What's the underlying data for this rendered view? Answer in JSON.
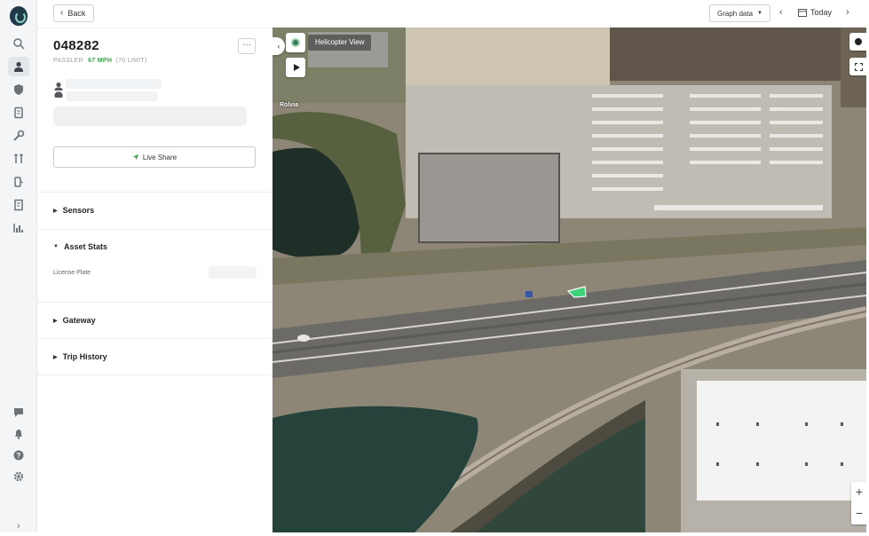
{
  "nav": {
    "back_label": "Back",
    "rail_icons": [
      "search-icon",
      "driver-icon",
      "shield-icon",
      "document-icon",
      "wrench-icon",
      "route-icon",
      "fuel-icon",
      "checklist-icon",
      "reports-icon",
      "chat-icon",
      "bell-icon",
      "help-icon",
      "settings-icon",
      "expand-icon"
    ],
    "expand_glyph": "›"
  },
  "asset": {
    "title": "048282",
    "type": "PASSLER",
    "speed": "67 MPH",
    "limit": "(70 LIMIT)"
  },
  "live_share_label": "Live Share",
  "sections": {
    "sensors": "Sensors",
    "asset_stats": "Asset Stats",
    "license_plate_label": "License Plate",
    "gateway": "Gateway",
    "trip_history": "Trip History"
  },
  "header": {
    "graph_data_label": "Graph data",
    "today_label": "Today",
    "prev_glyph": "‹",
    "next_glyph": "›"
  },
  "map": {
    "helicopter_view_label": "Helicopter View",
    "place_label": "Rolvia",
    "zoom_in": "+",
    "zoom_out": "−",
    "collapse_glyph": "‹",
    "more_glyph": "···"
  },
  "colors": {
    "accent_green": "#3aa34a",
    "vehicle_marker": "#3fd07a",
    "rail_bg": "#f4f5f6"
  }
}
